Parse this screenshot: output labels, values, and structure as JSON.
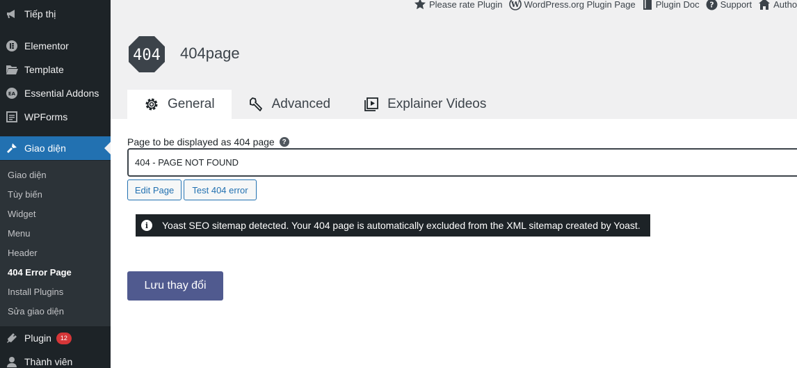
{
  "sidebar": {
    "items": [
      {
        "label": "Tiếp thị",
        "icon": "megaphone-icon"
      },
      {
        "label": "Elementor",
        "icon": "elementor-icon"
      },
      {
        "label": "Template",
        "icon": "folder-open-icon"
      },
      {
        "label": "Essential Addons",
        "icon": "essential-addons-icon"
      },
      {
        "label": "WPForms",
        "icon": "form-icon"
      },
      {
        "label": "Giao diện",
        "icon": "brush-icon"
      },
      {
        "label": "Plugin",
        "icon": "plug-icon",
        "badge": "12"
      },
      {
        "label": "Thành viên",
        "icon": "user-icon"
      }
    ],
    "submenu": [
      "Giao diện",
      "Tùy biến",
      "Widget",
      "Menu",
      "Header",
      "404 Error Page",
      "Install Plugins",
      "Sửa giao diện"
    ],
    "active_item": "Giao diện",
    "current_submenu": "404 Error Page"
  },
  "top_links": [
    {
      "label": "Please rate Plugin",
      "icon": "star-icon"
    },
    {
      "label": "WordPress.org Plugin Page",
      "icon": "wordpress-icon"
    },
    {
      "label": "Plugin Doc",
      "icon": "book-icon"
    },
    {
      "label": "Support",
      "icon": "question-icon"
    },
    {
      "label": "Authors We",
      "icon": "home-icon"
    }
  ],
  "header": {
    "logo_text": "404",
    "title": "404page"
  },
  "tabs": [
    {
      "label": "General",
      "icon": "gear-icon",
      "active": true
    },
    {
      "label": "Advanced",
      "icon": "wrench-icon",
      "active": false
    },
    {
      "label": "Explainer Videos",
      "icon": "video-icon",
      "active": false
    }
  ],
  "form": {
    "field_label": "Page to be displayed as 404 page",
    "help_glyph": "?",
    "selected_page": "404 - PAGE NOT FOUND",
    "edit_button": "Edit Page",
    "test_button": "Test 404 error"
  },
  "notice": {
    "icon_glyph": "i",
    "text": "Yoast SEO sitemap detected. Your 404 page is automatically excluded from the XML sitemap created by Yoast."
  },
  "save_button": "Lưu thay đổi",
  "colors": {
    "sidebar_bg": "#1d2327",
    "submenu_bg": "#2c3338",
    "active_bg": "#2271b1",
    "badge_bg": "#d63638",
    "save_button_bg": "#505a8f",
    "logo_bg": "#3c434a"
  }
}
